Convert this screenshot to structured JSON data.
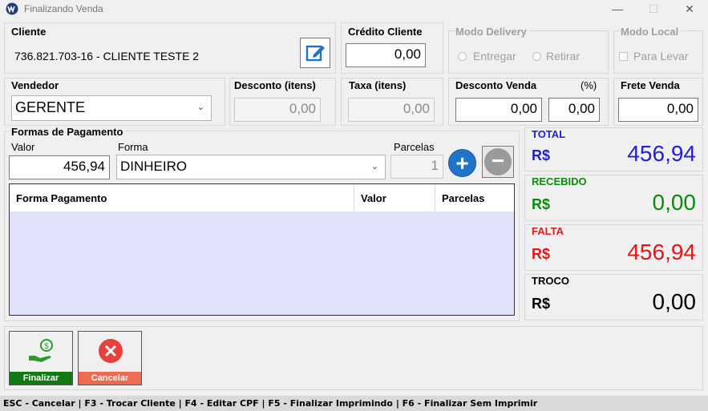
{
  "window": {
    "title": "Finalizando Venda",
    "min_glyph": "—",
    "max_glyph": "☐",
    "close_glyph": "✕"
  },
  "cliente": {
    "label": "Cliente",
    "value": "736.821.703-16 - CLIENTE TESTE 2",
    "edit_icon": "edit-icon"
  },
  "credito": {
    "label": "Crédito Cliente",
    "value": "0,00"
  },
  "delivery": {
    "label": "Modo Delivery",
    "entregar": "Entregar",
    "retirar": "Retirar"
  },
  "modo_local": {
    "label": "Modo Local",
    "para_levar": "Para Levar"
  },
  "vendedor": {
    "label": "Vendedor",
    "value": "GERENTE"
  },
  "desconto_itens": {
    "label": "Desconto (itens)",
    "value": "0,00"
  },
  "taxa_itens": {
    "label": "Taxa (itens)",
    "value": "0,00"
  },
  "desconto_venda": {
    "label": "Desconto Venda",
    "pct_label": "(%)",
    "value": "0,00",
    "pct_value": "0,00"
  },
  "frete": {
    "label": "Frete Venda",
    "value": "0,00"
  },
  "pagamento": {
    "label": "Formas de Pagamento",
    "valor_label": "Valor",
    "forma_label": "Forma",
    "parcelas_label": "Parcelas",
    "valor": "456,94",
    "forma": "DINHEIRO",
    "parcelas": "1",
    "add_glyph": "+",
    "remove_glyph": "−",
    "columns": [
      "Forma Pagamento",
      "Valor",
      "Parcelas"
    ]
  },
  "totais": {
    "currency": "R$",
    "total_label": "TOTAL",
    "total_value": "456,94",
    "recebido_label": "RECEBIDO",
    "recebido_value": "0,00",
    "falta_label": "FALTA",
    "falta_value": "456,94",
    "troco_label": "TROCO",
    "troco_value": "0,00",
    "colors": {
      "total": "#1f1fd4",
      "recebido": "#0c8a0c",
      "falta": "#e11616",
      "troco": "#000000"
    }
  },
  "actions": {
    "finalizar": "Finalizar",
    "cancelar": "Cancelar",
    "finalizar_color": "#0f7a0f",
    "cancelar_color": "#f06a52"
  },
  "status": {
    "text": "ESC - Cancelar | F3 - Trocar Cliente | F4 - Editar CPF | F5 - Finalizar Imprimindo | F6 - Finalizar Sem Imprimir"
  }
}
